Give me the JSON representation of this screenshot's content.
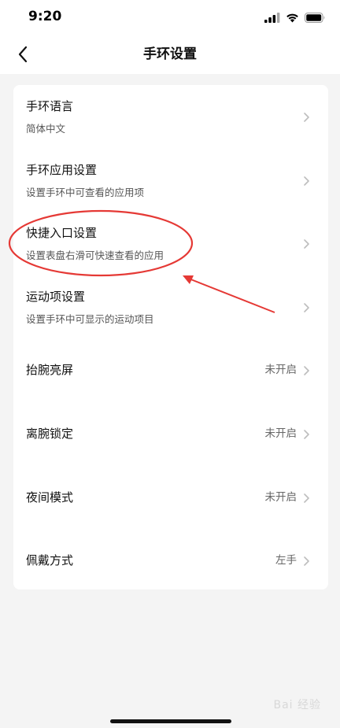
{
  "status": {
    "time": "9:20"
  },
  "nav": {
    "title": "手环设置"
  },
  "rows": [
    {
      "title": "手环语言",
      "subtitle": "简体中文"
    },
    {
      "title": "手环应用设置",
      "subtitle": "设置手环中可查看的应用项"
    },
    {
      "title": "快捷入口设置",
      "subtitle": "设置表盘右滑可快速查看的应用"
    },
    {
      "title": "运动项设置",
      "subtitle": "设置手环中可显示的运动项目"
    },
    {
      "title": "抬腕亮屏",
      "value": "未开启"
    },
    {
      "title": "离腕锁定",
      "value": "未开启"
    },
    {
      "title": "夜间模式",
      "value": "未开启"
    },
    {
      "title": "佩戴方式",
      "value": "左手"
    }
  ],
  "watermark": "Bai 经验",
  "colors": {
    "annotation": "#e53935",
    "background": "#f4f4f4",
    "card": "#ffffff"
  }
}
